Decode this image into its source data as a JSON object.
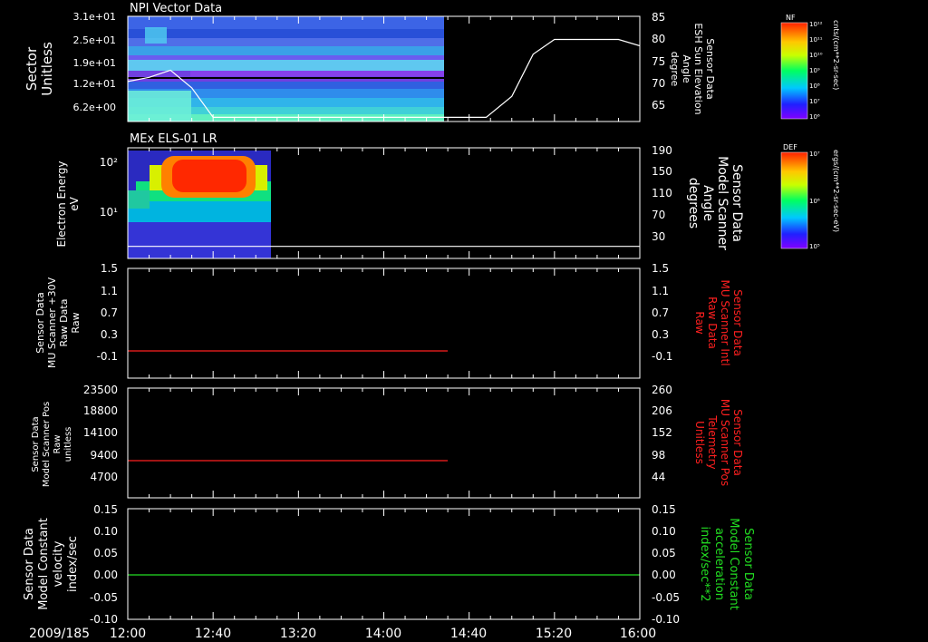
{
  "date_label": "2009/185",
  "time_axis": {
    "ticks": [
      "12:00",
      "12:40",
      "13:20",
      "14:00",
      "14:40",
      "15:20",
      "16:00"
    ],
    "start_hours": 12,
    "end_hours": 16
  },
  "panels": [
    {
      "title": "NPI Vector Data",
      "left_label": [
        "Sector",
        "Unitless"
      ],
      "left_ticks": [
        "3.1e+01",
        "2.5e+01",
        "1.9e+01",
        "1.2e+01",
        "6.2e+00"
      ],
      "right_label": [
        "Sensor Data",
        "ESH Sun Elevation",
        "Angle",
        "degree"
      ],
      "right_ticks": [
        "85",
        "80",
        "75",
        "70",
        "65"
      ],
      "color_scale": {
        "title": "NF",
        "ticks": [
          "10¹²",
          "10¹¹",
          "10¹⁰",
          "10⁹",
          "10⁸",
          "10⁷",
          "10⁶"
        ],
        "unit": "cnts/(cm**2-sr-sec)"
      }
    },
    {
      "title": "MEx ELS-01 LR",
      "left_label": [
        "Electron Energy",
        "eV"
      ],
      "left_ticks": [
        "10²",
        "10¹"
      ],
      "right_label": [
        "Sensor Data",
        "Model Scanner",
        "Angle",
        "degrees"
      ],
      "right_ticks": [
        "190",
        "150",
        "110",
        "70",
        "30"
      ],
      "color_scale": {
        "title": "DEF",
        "ticks": [
          "10⁷",
          "10⁶",
          "10⁵"
        ],
        "unit": "ergs/(cm**2-sr-sec-eV)"
      }
    },
    {
      "left_label": [
        "Sensor Data",
        "MU Scanner +30V",
        "Raw Data",
        "Raw"
      ],
      "left_ticks": [
        "1.5",
        "1.1",
        "0.7",
        "0.3",
        "-0.1"
      ],
      "right_label": [
        "Sensor Data",
        "MU Scanner Intl",
        "Raw Data",
        "Raw"
      ],
      "right_ticks": [
        "1.5",
        "1.1",
        "0.7",
        "0.3",
        "-0.1"
      ]
    },
    {
      "left_label": [
        "Sensor Data",
        "Model Scanner Pos",
        "Raw",
        "unitless"
      ],
      "left_ticks": [
        "23500",
        "18800",
        "14100",
        "9400",
        "4700"
      ],
      "right_label": [
        "Sensor Data",
        "MU Scanner Pos",
        "Telemetry",
        "Unitless"
      ],
      "right_ticks": [
        "260",
        "206",
        "152",
        "98",
        "44"
      ]
    },
    {
      "left_label": [
        "Sensor Data",
        "Model Constant",
        "velocity",
        "index/sec"
      ],
      "left_ticks": [
        "0.15",
        "0.10",
        "0.05",
        "0.00",
        "-0.05",
        "-0.10"
      ],
      "right_label": [
        "Sensor Data",
        "Model Constant",
        "acceleration",
        "index/sec**2"
      ],
      "right_ticks": [
        "0.15",
        "0.10",
        "0.05",
        "0.00",
        "-0.05",
        "-0.10"
      ]
    }
  ],
  "colors": {
    "axis": "#ffffff",
    "red_series": "#ff2020",
    "green_series": "#22dd22"
  },
  "chart_data": [
    {
      "type": "heatmap",
      "title": "NPI Vector Data",
      "ylabel": "Sector Unitless",
      "coverage_end": "14:28",
      "overlay_line": {
        "name": "ESH Sun Elevation Angle",
        "x": [
          "12:00",
          "12:10",
          "12:20",
          "12:30",
          "12:40",
          "14:28",
          "14:48",
          "15:00",
          "15:10",
          "15:20",
          "15:40",
          "15:50",
          "16:00"
        ],
        "y": [
          70.5,
          71.5,
          73.2,
          69,
          62,
          62,
          62,
          67,
          77,
          80.5,
          80.5,
          80.5,
          79
        ]
      }
    },
    {
      "type": "heatmap",
      "title": "MEx ELS-01 LR",
      "ylabel": "Electron Energy eV",
      "coverage_end": "13:00",
      "overlay_line": {
        "name": "Model Scanner Angle",
        "x": [
          "12:00",
          "13:00",
          "16:00"
        ],
        "y": [
          12,
          12,
          12
        ]
      }
    },
    {
      "type": "line",
      "series": [
        {
          "x": [
            "12:00",
            "14:30"
          ],
          "y": [
            0.0,
            0.0
          ]
        }
      ],
      "ylim": [
        -0.3,
        1.5
      ]
    },
    {
      "type": "line",
      "series": [
        {
          "x": [
            "12:00",
            "14:30"
          ],
          "y": [
            8300,
            8300
          ]
        }
      ],
      "ylim": [
        0,
        23500
      ]
    },
    {
      "type": "line",
      "series": [
        {
          "x": [
            "12:00",
            "16:00"
          ],
          "y": [
            0.0,
            0.0
          ]
        }
      ],
      "ylim": [
        -0.1,
        0.15
      ]
    }
  ]
}
